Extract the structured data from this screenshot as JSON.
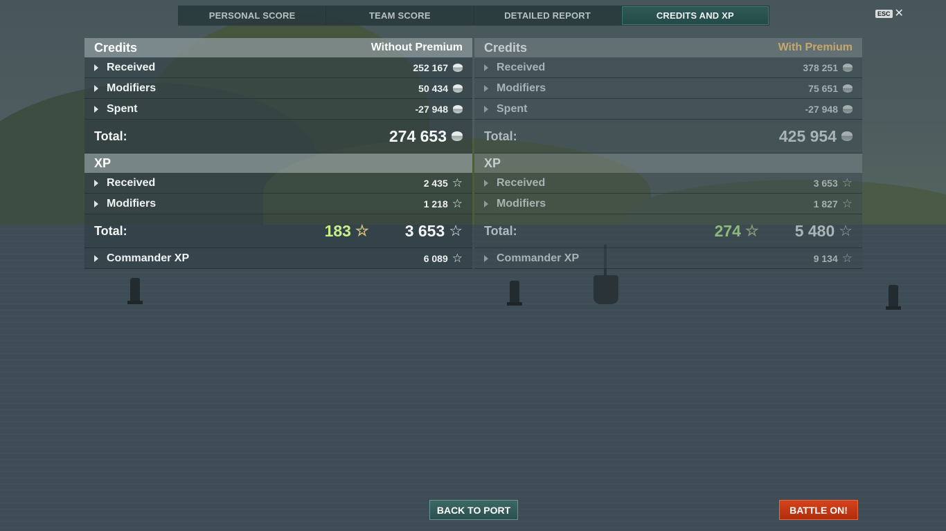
{
  "tabs": [
    {
      "label": "PERSONAL SCORE",
      "active": false
    },
    {
      "label": "TEAM SCORE",
      "active": false
    },
    {
      "label": "DETAILED REPORT",
      "active": false
    },
    {
      "label": "CREDITS AND XP",
      "active": true
    }
  ],
  "close": {
    "key_label": "ESC",
    "icon": "close-icon"
  },
  "without_premium": {
    "credits_title": "Credits",
    "mode_label": "Without Premium",
    "credits_rows": [
      {
        "label": "Received",
        "value": "252 167"
      },
      {
        "label": "Modifiers",
        "value": "50 434"
      },
      {
        "label": "Spent",
        "value": "-27 948"
      }
    ],
    "credits_total_label": "Total:",
    "credits_total": "274 653",
    "xp_title": "XP",
    "xp_rows": [
      {
        "label": "Received",
        "value": "2 435"
      },
      {
        "label": "Modifiers",
        "value": "1 218"
      }
    ],
    "xp_total_label": "Total:",
    "xp_total_bonus": "183",
    "xp_total": "3 653",
    "commander_label": "Commander XP",
    "commander_value": "6 089"
  },
  "with_premium": {
    "credits_title": "Credits",
    "mode_label": "With Premium",
    "credits_rows": [
      {
        "label": "Received",
        "value": "378 251"
      },
      {
        "label": "Modifiers",
        "value": "75 651"
      },
      {
        "label": "Spent",
        "value": "-27 948"
      }
    ],
    "credits_total_label": "Total:",
    "credits_total": "425 954",
    "xp_title": "XP",
    "xp_rows": [
      {
        "label": "Received",
        "value": "3 653"
      },
      {
        "label": "Modifiers",
        "value": "1 827"
      }
    ],
    "xp_total_label": "Total:",
    "xp_total_bonus": "274",
    "xp_total": "5 480",
    "commander_label": "Commander XP",
    "commander_value": "9 134"
  },
  "buttons": {
    "back_to_port": "BACK TO PORT",
    "battle_on": "BATTLE ON!"
  },
  "colors": {
    "accent_teal": "#2f5a58",
    "battle_red": "#c23a14",
    "premium_gold": "#c6a86a",
    "bonus_green": "#c8f08a"
  }
}
